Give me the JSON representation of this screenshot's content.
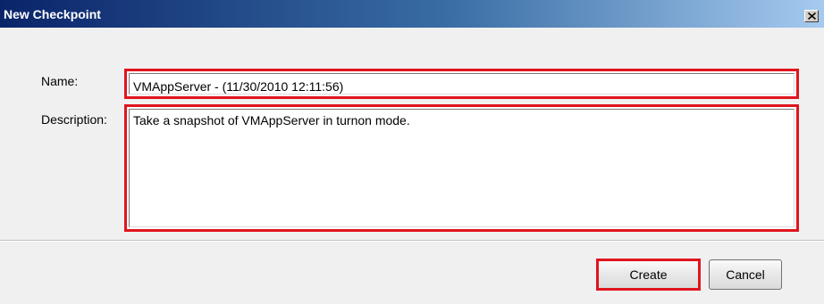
{
  "window": {
    "title": "New Checkpoint",
    "close_icon": "close-icon"
  },
  "form": {
    "name_label": "Name:",
    "name_value": "VMAppServer - (11/30/2010 12:11:56)",
    "description_label": "Description:",
    "description_value": "Take a snapshot of VMAppServer in turnon mode."
  },
  "buttons": {
    "create_label": "Create",
    "cancel_label": "Cancel"
  },
  "colors": {
    "highlight": "#e0141e",
    "titlebar_start": "#0a246a",
    "titlebar_end": "#a6caf0"
  }
}
